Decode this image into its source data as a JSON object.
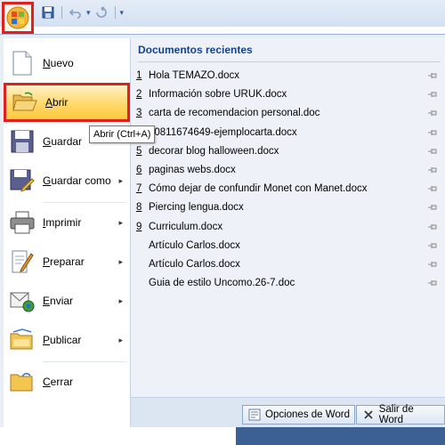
{
  "qat": {
    "items": [
      "save-icon",
      "undo-icon",
      "redo-icon",
      "customize-icon"
    ]
  },
  "menu": {
    "items": [
      {
        "label": "Nuevo",
        "icon": "new-document-icon",
        "has_submenu": false
      },
      {
        "label": "Abrir",
        "icon": "open-folder-icon",
        "has_submenu": false,
        "active": true
      },
      {
        "label": "Guardar",
        "icon": "save-icon",
        "has_submenu": false
      },
      {
        "label": "Guardar como",
        "icon": "save-as-icon",
        "has_submenu": true
      },
      {
        "label": "Imprimir",
        "icon": "print-icon",
        "has_submenu": true
      },
      {
        "label": "Preparar",
        "icon": "prepare-icon",
        "has_submenu": true
      },
      {
        "label": "Enviar",
        "icon": "send-icon",
        "has_submenu": true
      },
      {
        "label": "Publicar",
        "icon": "publish-icon",
        "has_submenu": true
      },
      {
        "label": "Cerrar",
        "icon": "close-folder-icon",
        "has_submenu": false
      }
    ],
    "submenu_arrow": "▸"
  },
  "tooltip": {
    "text": "Abrir (Ctrl+A)"
  },
  "recent": {
    "title": "Documentos recientes",
    "docs": [
      {
        "num": "1",
        "name": "Hola TEMAZO.docx"
      },
      {
        "num": "2",
        "name": "Información sobre URUK.docx"
      },
      {
        "num": "3",
        "name": "carta de recomendacion personal.doc"
      },
      {
        "num": "4",
        "name": "20811674649-ejemplocarta.docx"
      },
      {
        "num": "5",
        "name": "decorar blog halloween.docx"
      },
      {
        "num": "6",
        "name": "paginas webs.docx"
      },
      {
        "num": "7",
        "name": "Cómo dejar de confundir Monet con Manet.docx"
      },
      {
        "num": "8",
        "name": "Piercing lengua.docx"
      },
      {
        "num": "9",
        "name": "Curriculum.docx"
      },
      {
        "num": "",
        "name": "Artículo Carlos.docx"
      },
      {
        "num": "",
        "name": "Artículo Carlos.docx"
      },
      {
        "num": "",
        "name": "Guia de estilo Uncomo.26-7.doc"
      }
    ]
  },
  "buttons": {
    "options": "Opciones de Word",
    "exit": "Salir de Word"
  },
  "colors": {
    "accent_red": "#e01f1f",
    "title_blue": "#15428b",
    "active_gold": "#ffd86b"
  }
}
